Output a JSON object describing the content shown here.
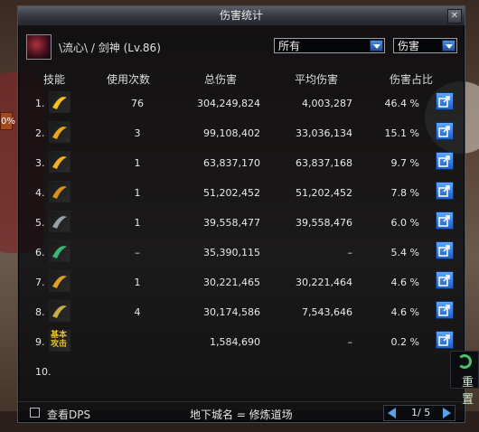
{
  "window": {
    "title": "伤害统计",
    "close_glyph": "✕"
  },
  "character": {
    "name": "\\流心\\ / 剑神 (Lv.86)"
  },
  "filters": {
    "target_select": "所有",
    "metric_select": "伤害"
  },
  "columns": {
    "skill": "技能",
    "uses": "使用次数",
    "total": "总伤害",
    "avg": "平均伤害",
    "pct": "伤害占比"
  },
  "rows": [
    {
      "n": "1.",
      "icon": "skill-dash-icon",
      "color": "#f2c21a",
      "uses": "76",
      "total": "304,249,824",
      "avg": "4,003,287",
      "pct": "46.4  %"
    },
    {
      "n": "2.",
      "icon": "skill-slash-icon",
      "color": "#e8a818",
      "uses": "3",
      "total": "99,108,402",
      "avg": "33,036,134",
      "pct": "15.1  %"
    },
    {
      "n": "3.",
      "icon": "skill-spiral-icon",
      "color": "#f0b020",
      "uses": "1",
      "total": "63,837,170",
      "avg": "63,837,168",
      "pct": "9.7  %"
    },
    {
      "n": "4.",
      "icon": "skill-vortex-icon",
      "color": "#d8901a",
      "uses": "1",
      "total": "51,202,452",
      "avg": "51,202,452",
      "pct": "7.8  %"
    },
    {
      "n": "5.",
      "icon": "skill-shield-icon",
      "color": "#9aa0a8",
      "uses": "1",
      "total": "39,558,477",
      "avg": "39,558,476",
      "pct": "6.0  %"
    },
    {
      "n": "6.",
      "icon": "skill-rune-icon",
      "color": "#3ab870",
      "uses": "–",
      "total": "35,390,115",
      "avg": "–",
      "pct": "5.4  %"
    },
    {
      "n": "7.",
      "icon": "skill-arc-icon",
      "color": "#e0a020",
      "uses": "1",
      "total": "30,221,465",
      "avg": "30,221,464",
      "pct": "4.6  %"
    },
    {
      "n": "8.",
      "icon": "skill-dragon-icon",
      "color": "#c8b040",
      "uses": "4",
      "total": "30,174,586",
      "avg": "7,543,646",
      "pct": "4.6  %"
    },
    {
      "n": "9.",
      "icon": "basic-attack-icon",
      "color": "#e8c020",
      "icon_text": "基本\n攻击",
      "uses": "",
      "total": "1,584,690",
      "avg": "–",
      "pct": "0.2  %"
    },
    {
      "n": "10.",
      "icon": "",
      "color": "",
      "uses": "",
      "total": "",
      "avg": "",
      "pct": ""
    }
  ],
  "footer": {
    "checkbox_label": "查看DPS",
    "dungeon": "地下城名 = 修炼道场",
    "page": "1/ 5"
  },
  "side": {
    "label": "重置",
    "edge_tab": "0%"
  }
}
